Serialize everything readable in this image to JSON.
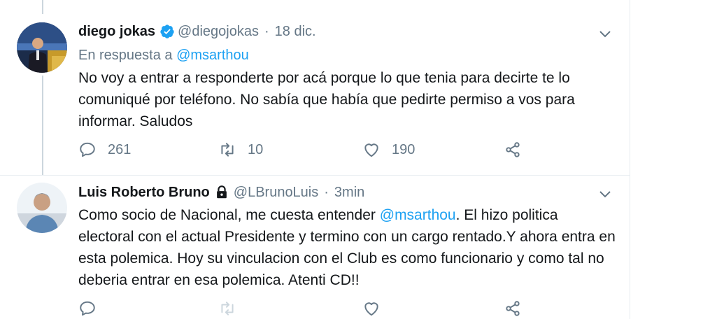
{
  "tweets": [
    {
      "author_name": "diego jokas",
      "handle": "@diegojokas",
      "separator": "·",
      "time": "18 dic.",
      "verified": true,
      "reply_prefix": "En respuesta a",
      "reply_to": "@msarthou",
      "text": "No voy a entrar a responderte por acá porque lo que tenia para decirte te lo comuniqué por teléfono. No sabía que había que pedirte permiso a vos para informar. Saludos",
      "replies": "261",
      "retweets": "10",
      "likes": "190"
    },
    {
      "author_name": "Luis Roberto Bruno",
      "handle": "@LBrunoLuis",
      "separator": "·",
      "time": "3min",
      "locked": true,
      "text_before_mention": "Como socio de Nacional, me cuesta entender ",
      "mention": "@msarthou",
      "text_after_mention": ". El hizo politica electoral con el actual Presidente y termino con un cargo rentado.Y ahora entra en esta polemica. Hoy su  vinculacion  con el Club es como funcionario y como tal no deberia entrar en esa polemica. Atenti CD!!"
    }
  ],
  "colors": {
    "link": "#1da1f2",
    "secondary_text": "#657786",
    "primary_text": "#14171a",
    "border": "#e6ecf0",
    "thread_line": "#ccd6dd"
  },
  "icons": [
    "verified-badge-icon",
    "lock-icon",
    "chevron-down-icon",
    "reply-icon",
    "retweet-icon",
    "like-icon",
    "share-icon"
  ]
}
